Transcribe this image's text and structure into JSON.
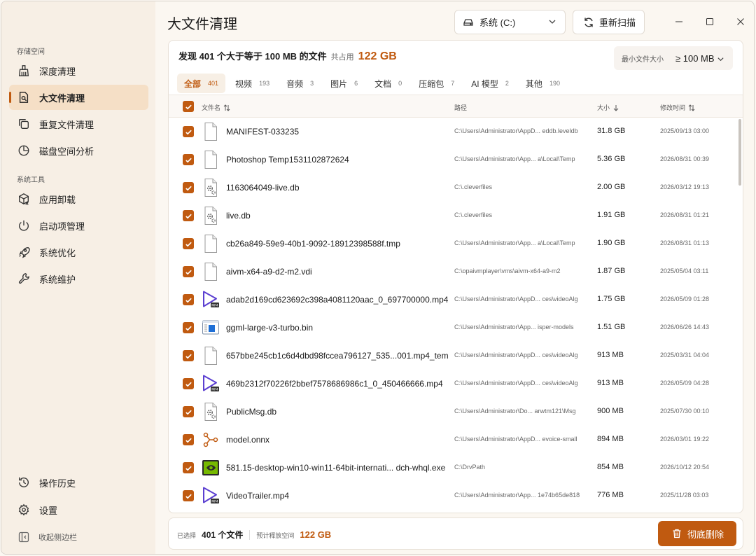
{
  "app": {
    "title": "大文件清理",
    "drive": "系统 (C:)",
    "rescan": "重新扫描"
  },
  "sidebar": {
    "section_storage": "存储空间",
    "section_tools": "系统工具",
    "items": [
      {
        "label": "深度清理",
        "icon": "broom-icon"
      },
      {
        "label": "大文件清理",
        "icon": "large-file-icon"
      },
      {
        "label": "重复文件清理",
        "icon": "copy-icon"
      },
      {
        "label": "磁盘空间分析",
        "icon": "pie-chart-icon"
      },
      {
        "label": "应用卸载",
        "icon": "package-remove-icon"
      },
      {
        "label": "启动项管理",
        "icon": "power-icon"
      },
      {
        "label": "系统优化",
        "icon": "rocket-icon"
      },
      {
        "label": "系统维护",
        "icon": "wrench-icon"
      }
    ],
    "history": "操作历史",
    "settings": "设置",
    "collapse": "收起侧边栏"
  },
  "summary": {
    "found": "发现 401 个大于等于 100 MB 的文件",
    "occupied_label": "共占用",
    "occupied": "122 GB",
    "min_size_label": "最小文件大小",
    "min_size_value": "≥ 100 MB"
  },
  "tabs": [
    {
      "label": "全部",
      "count": "401"
    },
    {
      "label": "视频",
      "count": "193"
    },
    {
      "label": "音频",
      "count": "3"
    },
    {
      "label": "图片",
      "count": "6"
    },
    {
      "label": "文档",
      "count": "0"
    },
    {
      "label": "压缩包",
      "count": "7"
    },
    {
      "label": "AI 模型",
      "count": "2"
    },
    {
      "label": "其他",
      "count": "190"
    }
  ],
  "columns": {
    "name": "文件名",
    "path": "路径",
    "size": "大小",
    "modified": "修改时间"
  },
  "rows": [
    {
      "name": "MANIFEST-033235",
      "path": "C:\\Users\\Administrator\\AppD... eddb.leveldb",
      "size": "31.8 GB",
      "date": "2025/09/13 03:00",
      "icon": "document-icon"
    },
    {
      "name": "Photoshop Temp1531102872624",
      "path": "C:\\Users\\Administrator\\App... a\\Local\\Temp",
      "size": "5.36 GB",
      "date": "2026/08/31 00:39",
      "icon": "document-icon"
    },
    {
      "name": "1163064049-live.db",
      "path": "C:\\.cleverfiles",
      "size": "2.00 GB",
      "date": "2026/03/12 19:13",
      "icon": "database-file-icon"
    },
    {
      "name": "live.db",
      "path": "C:\\.cleverfiles",
      "size": "1.91 GB",
      "date": "2026/08/31 01:21",
      "icon": "database-file-icon"
    },
    {
      "name": "cb26a849-59e9-40b1-9092-18912398588f.tmp",
      "path": "C:\\Users\\Administrator\\App... a\\Local\\Temp",
      "size": "1.90 GB",
      "date": "2026/08/31 01:13",
      "icon": "document-icon"
    },
    {
      "name": "aivm-x64-a9-d2-m2.vdi",
      "path": "C:\\opaivmplayer\\vms\\aivm-x64-a9-m2",
      "size": "1.87 GB",
      "date": "2025/05/04 03:11",
      "icon": "document-icon"
    },
    {
      "name": "adab2d169cd623692c398a4081120aac_0_697700000.mp4",
      "path": "C:\\Users\\Administrator\\AppD... ces\\videoAlg",
      "size": "1.75 GB",
      "date": "2026/05/09 01:28",
      "icon": "video-file-icon"
    },
    {
      "name": "ggml-large-v3-turbo.bin",
      "path": "C:\\Users\\Administrator\\App... isper-models",
      "size": "1.51 GB",
      "date": "2026/06/26 14:43",
      "icon": "binary-file-icon"
    },
    {
      "name": "657bbe245cb1c6d4dbd98fccea796127_535...001.mp4_temp",
      "path": "C:\\Users\\Administrator\\AppD... ces\\videoAlg",
      "size": "913 MB",
      "date": "2025/03/31 04:04",
      "icon": "document-icon"
    },
    {
      "name": "469b2312f70226f2bbef7578686986c1_0_450466666.mp4",
      "path": "C:\\Users\\Administrator\\AppD... ces\\videoAlg",
      "size": "913 MB",
      "date": "2026/05/09 04:28",
      "icon": "video-file-icon"
    },
    {
      "name": "PublicMsg.db",
      "path": "C:\\Users\\Administrator\\Do... arwtm121\\Msg",
      "size": "900 MB",
      "date": "2025/07/30 00:10",
      "icon": "database-file-icon"
    },
    {
      "name": "model.onnx",
      "path": "C:\\Users\\Administrator\\AppD... evoice-small",
      "size": "894 MB",
      "date": "2026/03/01 19:22",
      "icon": "model-file-icon"
    },
    {
      "name": "581.15-desktop-win10-win11-64bit-internati... dch-whql.exe",
      "path": "C:\\DrvPath",
      "size": "854 MB",
      "date": "2026/10/12 20:54",
      "icon": "nvidia-installer-icon"
    },
    {
      "name": "VideoTrailer.mp4",
      "path": "C:\\Users\\Administrator\\App... 1e74b65de818",
      "size": "776 MB",
      "date": "2025/11/28 03:03",
      "icon": "video-file-icon"
    }
  ],
  "footer": {
    "selected_label": "已选择",
    "selected_value": "401 个文件",
    "free_label": "预计释放空间",
    "free_value": "122 GB",
    "delete": "彻底删除"
  },
  "colors": {
    "accent": "#c05a10",
    "sidebar_bg": "#f7efe5",
    "active_bg": "#f5dfc6"
  }
}
